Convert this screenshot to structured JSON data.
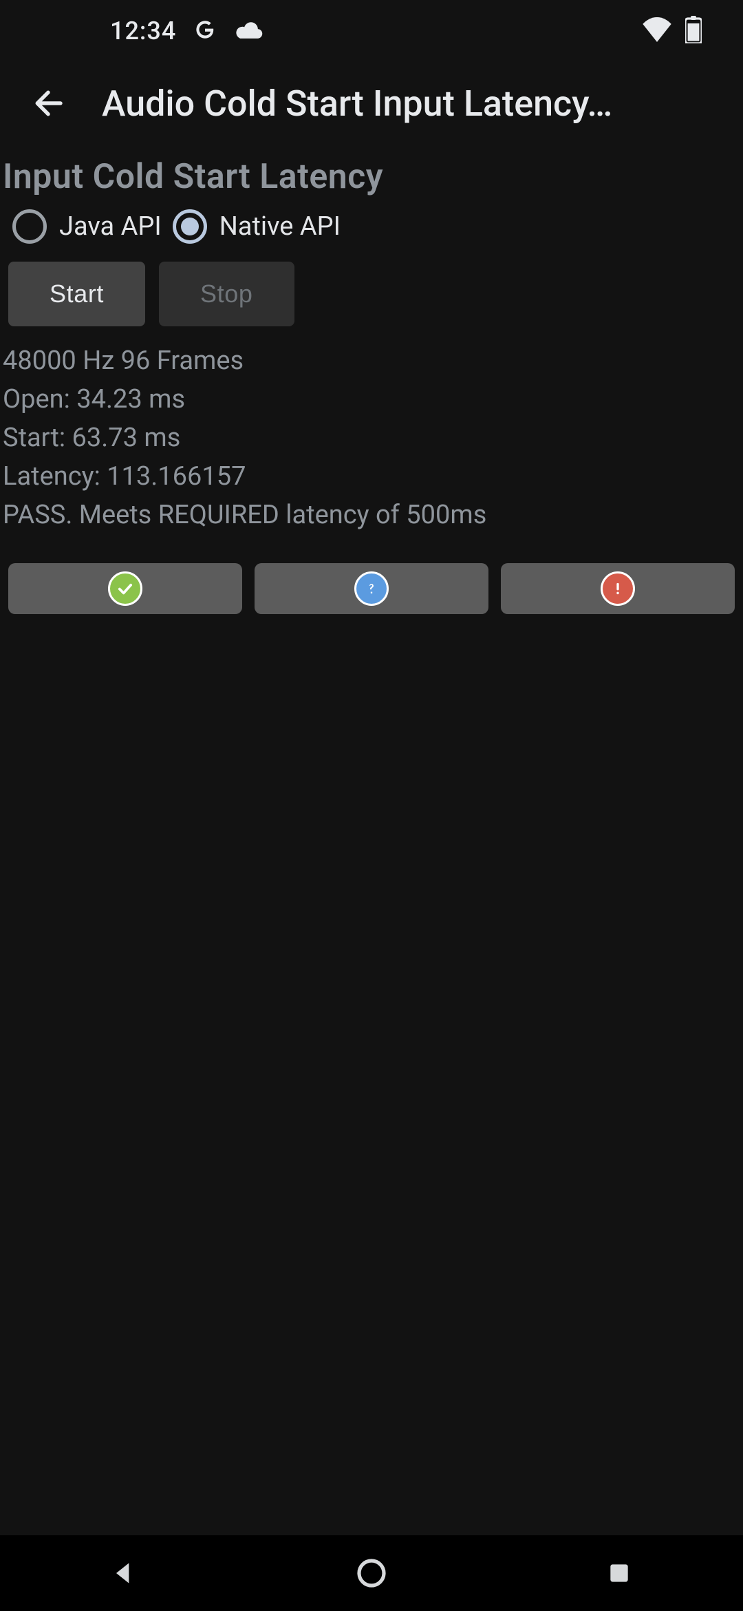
{
  "statusbar": {
    "time": "12:34"
  },
  "appbar": {
    "title": "Audio Cold Start Input Latency…"
  },
  "section": {
    "title": "Input Cold Start Latency"
  },
  "api": {
    "java_label": "Java API",
    "native_label": "Native API",
    "selected": "native"
  },
  "buttons": {
    "start": "Start",
    "stop": "Stop"
  },
  "readout": {
    "line1": "48000 Hz 96 Frames",
    "line2": "Open: 34.23 ms",
    "line3": "Start: 63.73 ms",
    "line4": "Latency: 113.166157",
    "line5": "PASS. Meets REQUIRED latency of 500ms"
  }
}
